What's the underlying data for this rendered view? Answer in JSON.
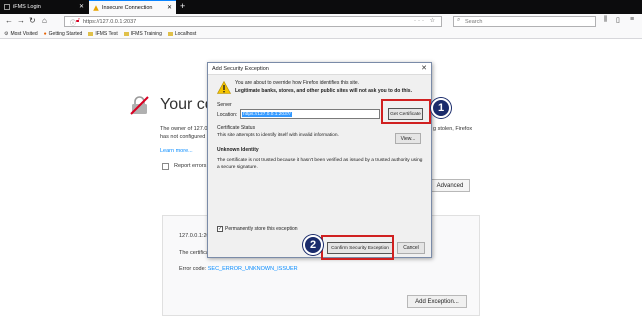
{
  "browser": {
    "tabs": [
      {
        "title": "iFMS Login",
        "active": false
      },
      {
        "title": "Insecure Connection",
        "active": true
      }
    ],
    "new_tab_symbol": "+",
    "url": "https://127.0.0.1:2037",
    "search_placeholder": "Search",
    "bookmarks": [
      "Most Visited",
      "Getting Started",
      "IFMS Test",
      "IFMS Training",
      "Localhost"
    ]
  },
  "page": {
    "title": "Your connection is not secure",
    "text_line1_left": "The owner of 127.0.0.1",
    "text_line2_left": "has not configured",
    "text_line1_right": "g stolen, Firefox",
    "learn_more": "Learn more...",
    "report_label": "Report errors",
    "advanced_button": "Advanced",
    "detail_host": "127.0.0.1:20",
    "detail_cert": "The certifica",
    "error_code_label": "Error code:",
    "error_code_value": "SEC_ERROR_UNKNOWN_ISSUER",
    "add_exception_button": "Add Exception..."
  },
  "dialog": {
    "title": "Add Security Exception",
    "warning_line1": "You are about to override how Firefox identifies this site.",
    "warning_line2": "Legitimate banks, stores, and other public sites will not ask you to do this.",
    "server_label": "Server",
    "location_label": "Location:",
    "location_value": "https://127.0.0.1:2037/",
    "get_certificate_button": "Get Certificate",
    "cert_status_label": "Certificate Status",
    "cert_status_text": "This site attempts to identify itself with invalid information.",
    "view_button": "View...",
    "unknown_identity": "Unknown Identity",
    "cert_detail_line1": "The certificate is not trusted because it hasn't been verified as issued by a trusted authority using",
    "cert_detail_line2": "a secure signature.",
    "permanent_checkbox_label": "Permanently store this exception",
    "permanent_checked": true,
    "confirm_button": "Confirm Security Exception",
    "cancel_button": "Cancel"
  },
  "annotations": {
    "badge_1": "1",
    "badge_2": "2",
    "highlight_color": "#d02020",
    "badge_color": "#1a2b6b"
  }
}
